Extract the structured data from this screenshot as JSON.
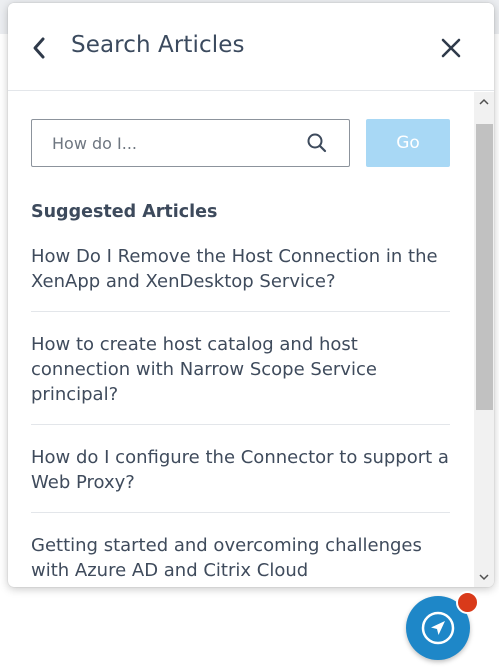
{
  "panel": {
    "title": "Search Articles"
  },
  "search": {
    "placeholder": "How do I...",
    "value": "",
    "go_label": "Go"
  },
  "suggested": {
    "heading": "Suggested Articles",
    "articles": [
      "How Do I Remove the Host Connection in the XenApp and XenDesktop Service?",
      "How to create host catalog and host connection with Narrow Scope Service principal?",
      "How do I configure the Connector to support a Web Proxy?",
      "Getting started and overcoming challenges with Azure AD and Citrix Cloud"
    ]
  },
  "icons": {
    "back": "chevron-left-icon",
    "close": "close-icon",
    "search": "search-icon",
    "fab": "navigation-arrow-icon"
  },
  "colors": {
    "go_button": "#a8d8f5",
    "fab": "#1e87c8",
    "badge": "#d93a1a",
    "text": "#3d4a5c"
  }
}
